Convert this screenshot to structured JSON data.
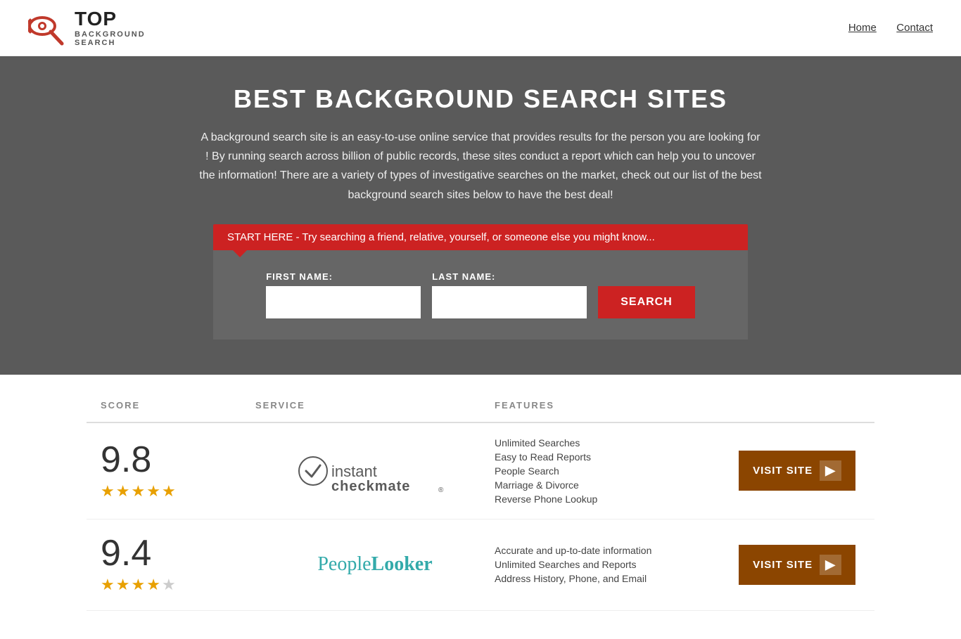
{
  "header": {
    "logo_top": "TOP",
    "logo_sub": "BACKGROUND\nSEARCH",
    "nav": {
      "home": "Home",
      "contact": "Contact"
    }
  },
  "hero": {
    "title": "BEST BACKGROUND SEARCH SITES",
    "description": "A background search site is an easy-to-use online service that provides results  for the person you are looking for ! By  running  search across billion of public records, these sites conduct  a report which can help you to uncover the information! There are a variety of types of investigative searches on the market, check out our  list of the best background search sites below to have the best deal!",
    "callout": "START HERE - Try searching a friend, relative, yourself, or someone else you might know...",
    "form": {
      "first_name_label": "FIRST NAME:",
      "last_name_label": "LAST NAME:",
      "search_btn": "SEARCH"
    }
  },
  "table": {
    "headers": {
      "score": "SCORE",
      "service": "SERVICE",
      "features": "FEATURES"
    },
    "rows": [
      {
        "score": "9.8",
        "stars": 4.5,
        "service_name": "Instant Checkmate",
        "features": [
          "Unlimited Searches",
          "Easy to Read Reports",
          "People Search",
          "Marriage & Divorce",
          "Reverse Phone Lookup"
        ],
        "visit_label": "VISIT SITE"
      },
      {
        "score": "9.4",
        "stars": 4,
        "service_name": "PeopleLooker",
        "features": [
          "Accurate and up-to-date information",
          "Unlimited Searches and Reports",
          "Address History, Phone, and Email"
        ],
        "visit_label": "VISIT SITE"
      }
    ]
  }
}
